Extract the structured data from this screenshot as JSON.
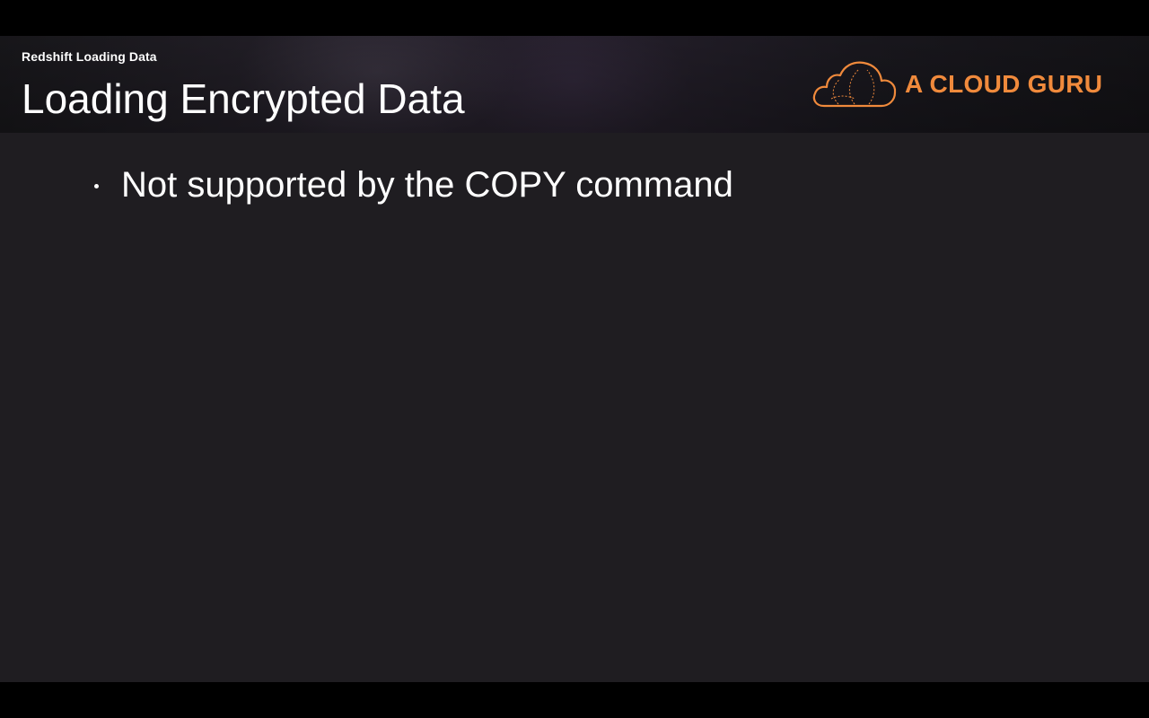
{
  "header": {
    "section_label": "Redshift Loading Data",
    "title": "Loading Encrypted Data"
  },
  "logo": {
    "text": "A CLOUD GURU",
    "icon": "cloud-icon",
    "color": "#f08a3c"
  },
  "content": {
    "bullets": [
      "Not supported by the COPY command"
    ]
  },
  "colors": {
    "slide_background": "#1f1d21",
    "text": "#ffffff",
    "accent": "#f08a3c"
  }
}
